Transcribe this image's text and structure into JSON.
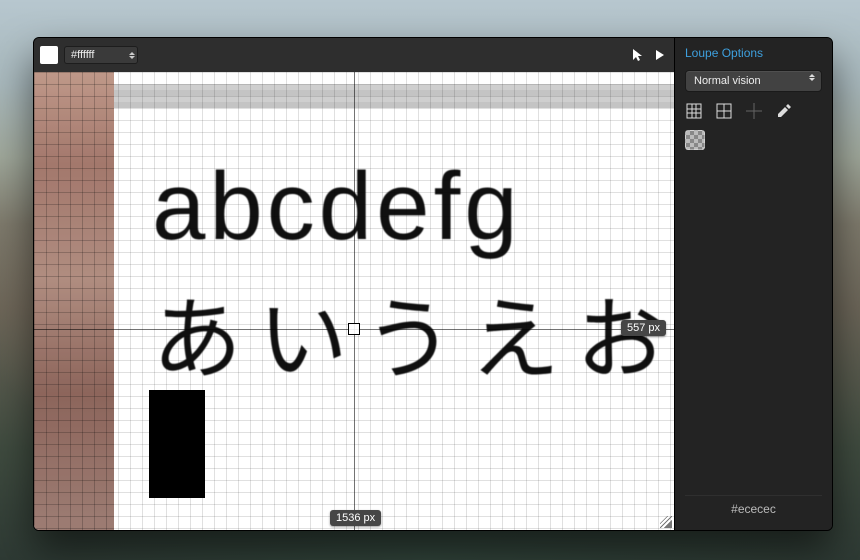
{
  "toolbar": {
    "swatch_color": "#ffffff",
    "hex_value": "#ffffff"
  },
  "sidebar": {
    "title": "Loupe Options",
    "simulation_selected": "Normal vision",
    "footer_hex": "#ececec"
  },
  "viewport": {
    "line1_text": "abcdefg",
    "line2_text": "あいうえお",
    "cursor_x_label": "1536 px",
    "cursor_y_label": "557 px"
  },
  "icons": {
    "pointer": "pointer-icon",
    "play": "play-icon",
    "grid9": "grid-3x3-icon",
    "grid4": "grid-2x2-icon",
    "crosshair": "crosshair-icon",
    "eyedropper": "eyedropper-icon"
  }
}
